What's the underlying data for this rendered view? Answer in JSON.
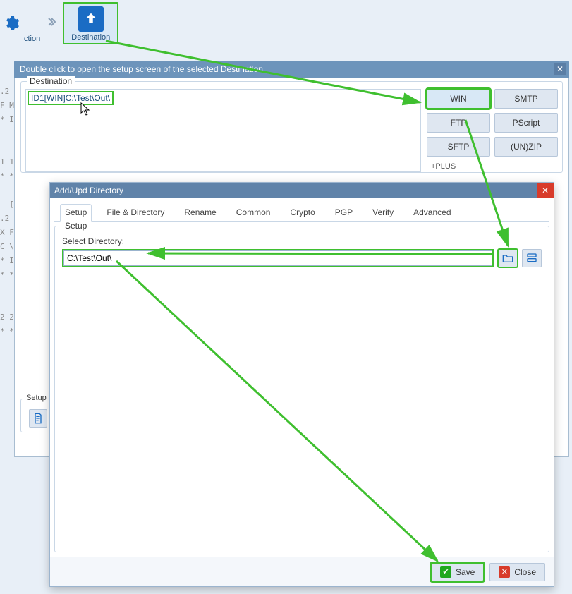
{
  "ribbon": {
    "action_label_cut": "ction",
    "destination_label": "Destination"
  },
  "infobar": {
    "text": "Double click to open the setup screen of the selected Destination"
  },
  "destination": {
    "group_label": "Destination",
    "listitem": "ID1[WIN]C:\\Test\\Out\\",
    "plus_label": "+PLUS",
    "buttons": {
      "win": "WIN",
      "smtp": "SMTP",
      "ftp": "FTP",
      "pscript": "PScript",
      "sftp": "SFTP",
      "unzip": "(UN)ZIP"
    }
  },
  "setup_small": {
    "label": "Setup"
  },
  "dialog": {
    "title": "Add/Upd Directory",
    "tabs": {
      "setup": "Setup",
      "filedir": "File & Directory",
      "rename": "Rename",
      "common": "Common",
      "crypto": "Crypto",
      "pgp": "PGP",
      "verify": "Verify",
      "advanced": "Advanced"
    },
    "group_label": "Setup",
    "select_dir_label": "Select Directory:",
    "dir_value": "C:\\Test\\Out\\",
    "save_label": "Save",
    "close_label": "Close"
  },
  "leftstrip": ".2\nF M\n* I\n  \n  \n1 1\n* *\n  \n  [\n.2\nX F\nC \\\n* I\n* *\n  \n  \n2 2\n* *"
}
